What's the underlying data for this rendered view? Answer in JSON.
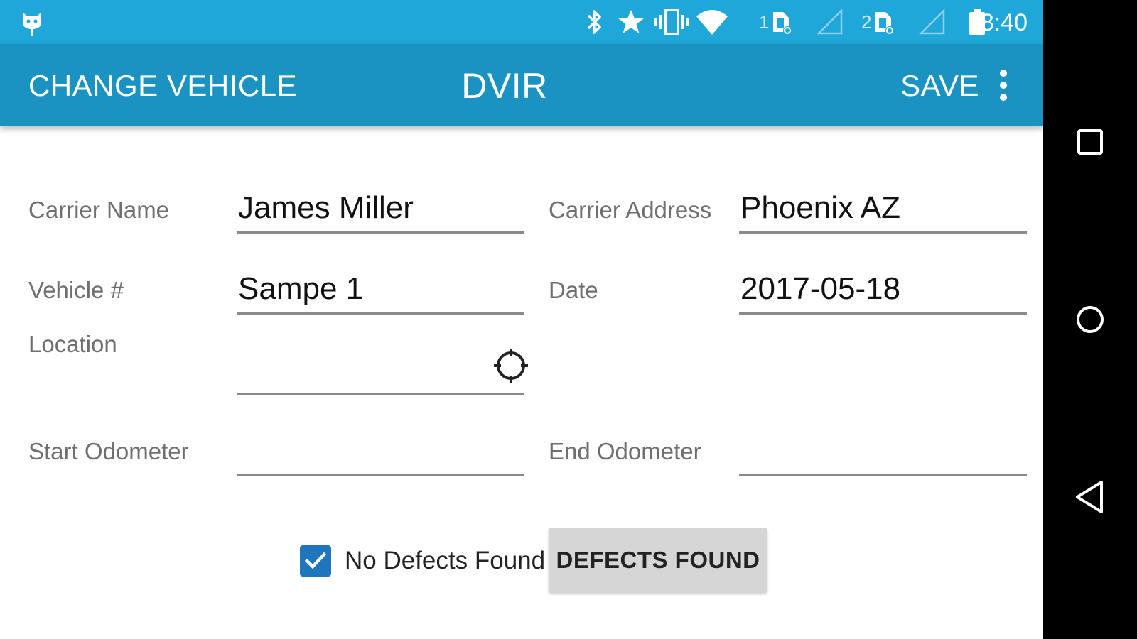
{
  "status_bar": {
    "time": "8:40",
    "sim1": "1",
    "sim2": "2",
    "icons": [
      "app-notification-icon",
      "bluetooth-icon",
      "star-icon",
      "vibrate-icon",
      "wifi-icon",
      "sim-card-icon",
      "signal-icon",
      "battery-icon"
    ]
  },
  "action_bar": {
    "change_vehicle_label": "CHANGE VEHICLE",
    "title": "DVIR",
    "save_label": "SAVE"
  },
  "form": {
    "carrier_name": {
      "label": "Carrier Name",
      "value": "James Miller"
    },
    "carrier_address": {
      "label": "Carrier Address",
      "value": "Phoenix AZ"
    },
    "vehicle_number": {
      "label": "Vehicle #",
      "value": "Sampe 1"
    },
    "date": {
      "label": "Date",
      "value": "2017-05-18"
    },
    "location": {
      "label": "Location",
      "value": ""
    },
    "start_odometer": {
      "label": "Start Odometer",
      "value": ""
    },
    "end_odometer": {
      "label": "End Odometer",
      "value": ""
    }
  },
  "defects": {
    "no_defects_label": "No Defects Found",
    "no_defects_checked": true,
    "defects_found_label": "DEFECTS FOUND"
  },
  "colors": {
    "status_bar": "#1ea7d8",
    "action_bar": "#1a92c2",
    "checkbox": "#1f76bc"
  }
}
